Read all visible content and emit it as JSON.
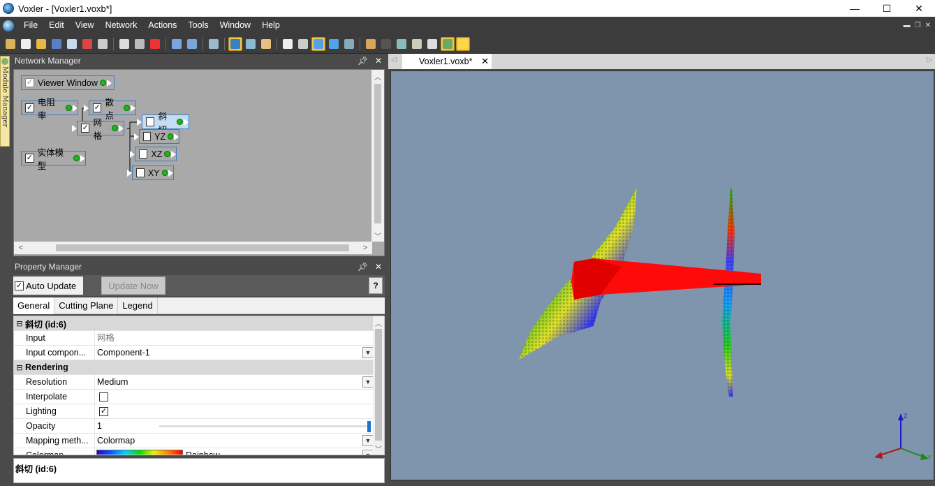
{
  "window": {
    "title": "Voxler - [Voxler1.voxb*]",
    "controls": [
      "—",
      "☐",
      "✕"
    ]
  },
  "menu": [
    "File",
    "Edit",
    "View",
    "Network",
    "Actions",
    "Tools",
    "Window",
    "Help"
  ],
  "side_tab": {
    "label": "Module Manager"
  },
  "network_manager": {
    "title": "Network Manager",
    "nodes": {
      "viewer_window": {
        "label": "Viewer Window",
        "checked": true
      },
      "resistivity": {
        "label": "电阻率",
        "checked": true
      },
      "scatter": {
        "label": "散点",
        "checked": true
      },
      "grid": {
        "label": "网格",
        "checked": true
      },
      "oblique": {
        "label": "斜切",
        "checked": false
      },
      "yz": {
        "label": "YZ",
        "checked": false
      },
      "xz": {
        "label": "XZ",
        "checked": false
      },
      "xy": {
        "label": "XY",
        "checked": false
      },
      "solid_model": {
        "label": "实体模型",
        "checked": true
      }
    }
  },
  "property_manager": {
    "title": "Property Manager",
    "auto_update_label": "Auto Update",
    "update_now_label": "Update Now",
    "help_label": "?",
    "tabs": [
      "General",
      "Cutting Plane",
      "Legend"
    ],
    "section_title": "斜切 (id:6)",
    "rows": {
      "input": {
        "key": "Input",
        "value": "网格"
      },
      "input_component": {
        "key": "Input compon...",
        "value": "Component-1"
      },
      "rendering_section": "Rendering",
      "resolution": {
        "key": "Resolution",
        "value": "Medium"
      },
      "interpolate": {
        "key": "Interpolate",
        "checked": false
      },
      "lighting": {
        "key": "Lighting",
        "checked": true
      },
      "opacity": {
        "key": "Opacity",
        "value": "1",
        "level": 1.0
      },
      "mapping_method": {
        "key": "Mapping meth...",
        "value": "Colormap"
      },
      "colormap": {
        "key": "Colormap",
        "value": "Rainbow"
      }
    },
    "status_text": "斜切 (id:6)"
  },
  "document": {
    "tab_label": "Voxler1.voxb*",
    "tab_close": "✕"
  },
  "viewer": {
    "background_color": "#7f95ad",
    "axes_labels": {
      "z": "Z",
      "y": "Y"
    }
  }
}
